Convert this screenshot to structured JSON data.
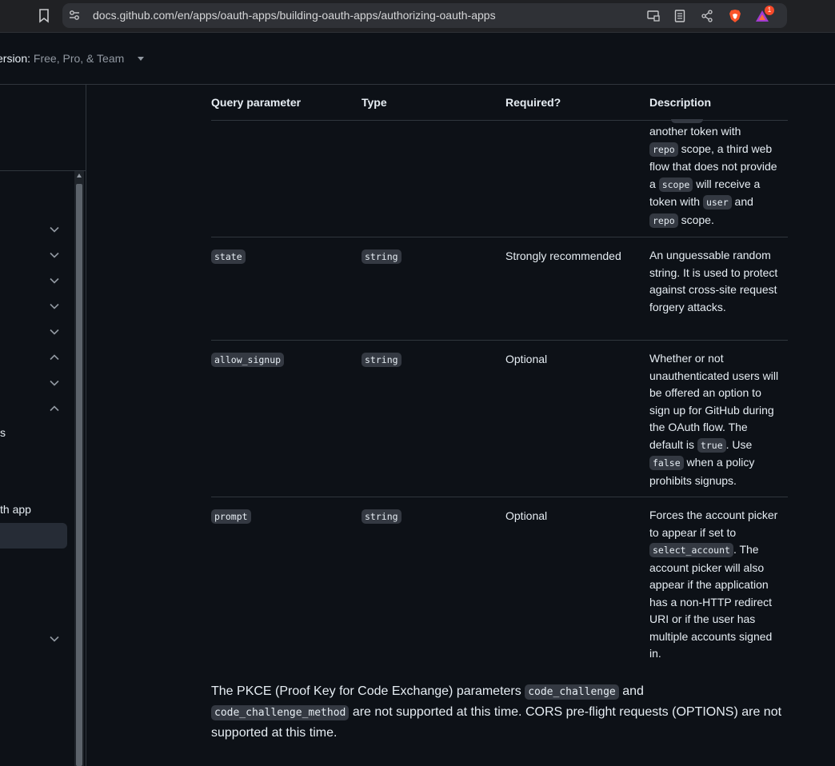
{
  "browser": {
    "url": "docs.github.com/en/apps/oauth-apps/building-oauth-apps/authorizing-oauth-apps",
    "brave_rewards_badge": "1"
  },
  "header": {
    "version_label": "ersion: ",
    "version_value": "Free, Pro, & Team"
  },
  "sidebar": {
    "partial_items": [
      "s",
      "th app"
    ]
  },
  "table": {
    "headers": [
      "Query parameter",
      "Type",
      "Required?",
      "Description"
    ],
    "scope_row_tail": {
      "l1": "another token with",
      "c1": "repo",
      "l2": " scope, a third web flow that does not provide a ",
      "c2": "scope",
      "l3": " will receive a token with ",
      "c3": "user",
      "l4": " and ",
      "c4": "repo",
      "l5": " scope."
    },
    "rows": [
      {
        "param": "state",
        "type": "string",
        "required": "Strongly recommended",
        "description": "An unguessable random string. It is used to protect against cross-site request forgery attacks."
      },
      {
        "param": "allow_signup",
        "type": "string",
        "required": "Optional",
        "d1": "Whether or not unauthenticated users will be offered an option to sign up for GitHub during the OAuth flow. The default is ",
        "c1": "true",
        "d2": ". Use ",
        "c2": "false",
        "d3": " when a policy prohibits signups."
      },
      {
        "param": "prompt",
        "type": "string",
        "required": "Optional",
        "d1": "Forces the account picker to appear if set to ",
        "c1": "select_account",
        "d2": ". The account picker will also appear if the application has a non-HTTP redirect URI or if the user has multiple accounts signed in."
      }
    ]
  },
  "note": {
    "p1": "The PKCE (Proof Key for Code Exchange) parameters ",
    "c1": "code_challenge",
    "p2": " and ",
    "c2": "code_challenge_method",
    "p3": " are not supported at this time. CORS pre-flight requests (OPTIONS) are not supported at this time."
  }
}
